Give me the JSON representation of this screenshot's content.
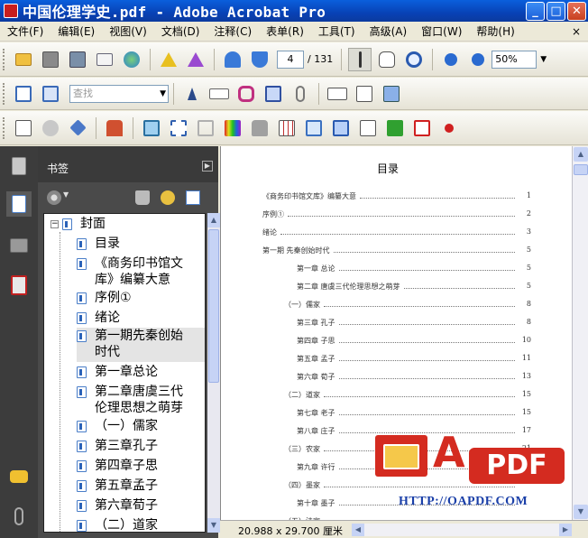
{
  "window": {
    "title": "中国伦理学史.pdf - Adobe Acrobat Pro",
    "minimize": "_",
    "maximize": "□",
    "close": "✕"
  },
  "menu": {
    "items": [
      "文件(F)",
      "编辑(E)",
      "视图(V)",
      "文档(D)",
      "注释(C)",
      "表单(R)",
      "工具(T)",
      "高级(A)",
      "窗口(W)",
      "帮助(H)"
    ],
    "close_doc": "×"
  },
  "toolbar1": {
    "page_current": "4",
    "page_total": "/ 131",
    "zoom": "50%"
  },
  "toolbar2": {
    "find_placeholder": "查找"
  },
  "nav": {
    "panel_title": "书签",
    "tree": [
      {
        "label": "封面",
        "level": 0
      },
      {
        "label": "目录",
        "level": 1
      },
      {
        "label": "《商务印书馆文",
        "label2": "库》编纂大意",
        "level": 1
      },
      {
        "label": "序例①",
        "level": 1
      },
      {
        "label": "绪论",
        "level": 1
      },
      {
        "label": "第一期先秦创始",
        "label2": "时代",
        "level": 1,
        "selected": true
      },
      {
        "label": "第一章总论",
        "level": 1
      },
      {
        "label": "第二章唐虞三代",
        "label2": "伦理思想之萌芽",
        "level": 1
      },
      {
        "label": "（一）儒家",
        "level": 1
      },
      {
        "label": "第三章孔子",
        "level": 1
      },
      {
        "label": "第四章子思",
        "level": 1
      },
      {
        "label": "第五章孟子",
        "level": 1
      },
      {
        "label": "第六章荀子",
        "level": 1
      },
      {
        "label": "（二）道家",
        "level": 1
      }
    ]
  },
  "document": {
    "heading": "目录",
    "toc": [
      {
        "text": "《商务印书馆文库》编纂大意",
        "page": "1",
        "indent": 0
      },
      {
        "text": "序例①",
        "page": "2",
        "indent": 0
      },
      {
        "text": "绪论",
        "page": "3",
        "indent": 0
      },
      {
        "text": "第一期 先秦创始时代",
        "page": "5",
        "indent": 0
      },
      {
        "text": "第一章 总论",
        "page": "5",
        "indent": 2
      },
      {
        "text": "第二章 唐虞三代伦理思想之萌芽",
        "page": "5",
        "indent": 2
      },
      {
        "text": "（一）儒家",
        "page": "8",
        "indent": 1
      },
      {
        "text": "第三章 孔子",
        "page": "8",
        "indent": 2
      },
      {
        "text": "第四章 子思",
        "page": "10",
        "indent": 2
      },
      {
        "text": "第五章 孟子",
        "page": "11",
        "indent": 2
      },
      {
        "text": "第六章 荀子",
        "page": "13",
        "indent": 2
      },
      {
        "text": "（二）道家",
        "page": "15",
        "indent": 1
      },
      {
        "text": "第七章 老子",
        "page": "15",
        "indent": 2
      },
      {
        "text": "第八章 庄子",
        "page": "17",
        "indent": 2
      },
      {
        "text": "（三）农家",
        "page": "21",
        "indent": 1
      },
      {
        "text": "第九章 许行",
        "page": "21",
        "indent": 2
      },
      {
        "text": "（四）墨家",
        "page": "",
        "indent": 1
      },
      {
        "text": "第十章 墨子",
        "page": "",
        "indent": 2
      },
      {
        "text": "（五）法家",
        "page": "",
        "indent": 1
      }
    ]
  },
  "status": {
    "page_size": "20.988 x 29.700 厘米"
  },
  "watermark": {
    "a": "A",
    "pdf": "PDF",
    "url": "HTTP://OAPDF.COM"
  },
  "colors": {
    "titlebar": "#0842b6",
    "nav_panel": "#4a4a4a",
    "watermark_red": "#d42b20",
    "watermark_blue": "#1a3fa8"
  }
}
